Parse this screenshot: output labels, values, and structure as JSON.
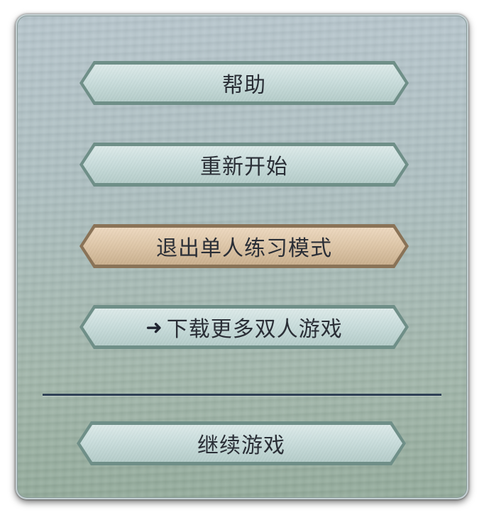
{
  "menu": {
    "items": [
      {
        "label": "帮助"
      },
      {
        "label": "重新开始"
      },
      {
        "label": "退出单人练习模式"
      },
      {
        "label": "下载更多双人游戏",
        "icon": "arrow-right-icon"
      }
    ],
    "resume_label": "继续游戏"
  },
  "colors": {
    "button_face": "#c8dcdb",
    "button_border": "#6f8f88",
    "active_face": "#dcc4a5",
    "active_border": "#8a7357",
    "divider": "#2e4055"
  }
}
